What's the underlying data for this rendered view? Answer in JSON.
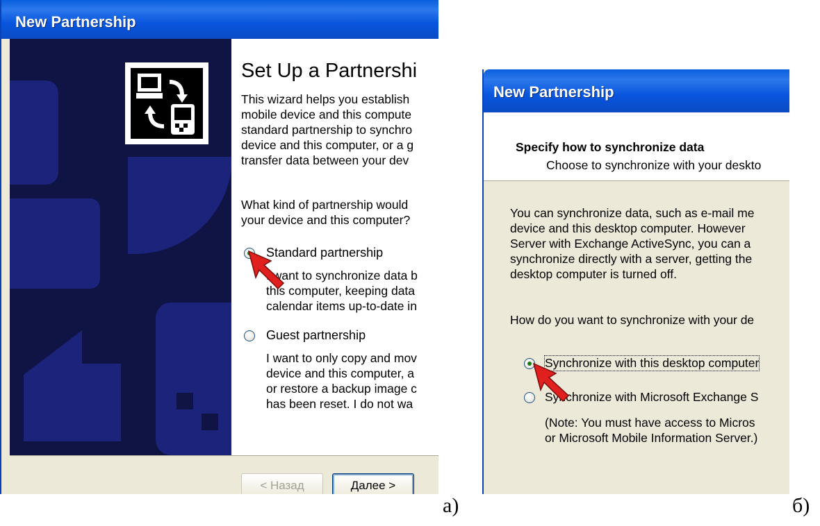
{
  "window_a": {
    "title": "New Partnership",
    "heading": "Set Up a Partnershi",
    "intro_lines": [
      "This wizard helps you establish",
      "mobile device and this compute",
      "standard partnership to synchro",
      "device and this computer, or a g",
      "transfer data between your dev"
    ],
    "question_lines": [
      "What kind of partnership would",
      "your device and this computer?"
    ],
    "options": [
      {
        "label": "Standard partnership",
        "checked": true,
        "description": [
          "I want to synchronize data b",
          "this computer, keeping data",
          "calendar items up-to-date in"
        ]
      },
      {
        "label": "Guest partnership",
        "checked": false,
        "description": [
          "I want to only copy and mov",
          "device and this computer, a",
          "or restore a backup image c",
          "has been reset. I do not wa"
        ]
      }
    ],
    "back_button": "< Назад",
    "next_button": "Далее >",
    "caption": "а)"
  },
  "window_b": {
    "title": "New Partnership",
    "heading": "Specify how to synchronize data",
    "subheading": "Choose to synchronize with your deskto",
    "body_lines": [
      "You can synchronize data, such as e-mail me",
      "device and this desktop computer.  However",
      "Server with Exchange ActiveSync, you can a",
      "synchronize directly with a server, getting the",
      "desktop computer is turned off."
    ],
    "question": "How do you want to synchronize with your de",
    "options": [
      {
        "label": "Synchronize with this desktop computer",
        "checked": true
      },
      {
        "label": "Synchronize with Microsoft Exchange S",
        "checked": false
      }
    ],
    "note_lines": [
      "(Note: You must have access to Micros",
      "or Microsoft Mobile Information Server.)"
    ],
    "caption": "б)"
  },
  "colors": {
    "title_bar": "#0a5fdc",
    "art_panel": "#0f1444",
    "art_shapes": "#1b247a",
    "dialog_face": "#ece9d8",
    "pointer_arrow": "#e0201e"
  },
  "icons": [
    "wizard-sync-icon",
    "pointer-arrow-icon"
  ]
}
